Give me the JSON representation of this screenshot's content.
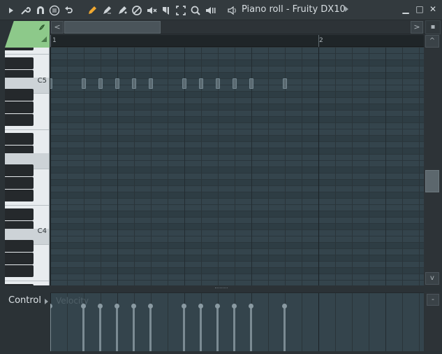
{
  "window": {
    "title": "Piano roll - Fruity DX10",
    "minimize_glyph": "▁",
    "maximize_glyph": "□",
    "close_glyph": "✕"
  },
  "toolbar": {
    "icons": [
      {
        "name": "menu-arrow-icon",
        "glyph": "▸"
      },
      {
        "name": "wrench-icon",
        "glyph": "🔧"
      },
      {
        "name": "magnet-icon",
        "glyph": "∩"
      },
      {
        "name": "list-icon",
        "glyph": "≡"
      },
      {
        "name": "undo-icon",
        "glyph": "↶"
      },
      {
        "name": "pencil-icon",
        "glyph": "✎"
      },
      {
        "name": "brush-icon",
        "glyph": "✐"
      },
      {
        "name": "paint-brush-icon",
        "glyph": "✑"
      },
      {
        "name": "delete-icon",
        "glyph": "⊘"
      },
      {
        "name": "mute-icon",
        "glyph": "✕"
      },
      {
        "name": "slice-icon",
        "glyph": "✂"
      },
      {
        "name": "select-icon",
        "glyph": "⬚"
      },
      {
        "name": "zoom-icon",
        "glyph": "🔍"
      },
      {
        "name": "playback-icon",
        "glyph": "◀"
      }
    ],
    "speaker_glyph": "🔈"
  },
  "scroll": {
    "left_glyph": "<",
    "right_glyph": ">",
    "up_glyph": "^",
    "down_glyph": "v",
    "corner_glyph": "▪"
  },
  "ruler": {
    "bars": [
      "1",
      "2"
    ]
  },
  "keyboard": {
    "labels": [
      "C5",
      "C4"
    ]
  },
  "control": {
    "label": "Control",
    "target": "Velocity",
    "side_glyph": "-"
  },
  "notes": {
    "count": 12
  }
}
